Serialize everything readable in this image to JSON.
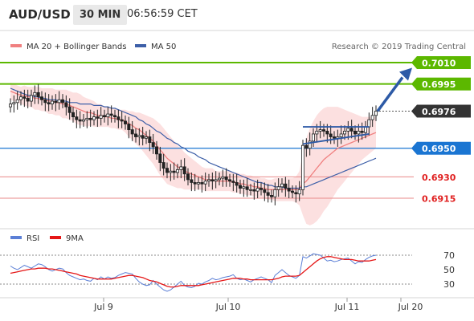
{
  "header": {
    "symbol": "AUD/USD",
    "timeframe": "30 MIN",
    "clock": "06:56:59 CET"
  },
  "legend": {
    "bollinger": "MA 20 + Bollinger Bands",
    "ma50": "MA 50",
    "credit": "Research © 2019 Trading Central",
    "rsi": "RSI",
    "rsi_ma": "9MA"
  },
  "colors": {
    "bollinger": "#f08080",
    "band_fill": "#fbdada",
    "ma50": "#3d5fa8",
    "green_level": "#5cb800",
    "blue_level": "#1a75d2",
    "red_level": "#e88a8a",
    "arrow": "#2d5aa6",
    "current": "#333333",
    "candle": "#222222",
    "rsi": "#5b7fd6",
    "rsi_ma": "#e51616"
  },
  "chart_data": [
    {
      "type": "candlestick",
      "name": "price",
      "levels": [
        {
          "value": 0.701,
          "label": "0.7010",
          "kind": "resistance",
          "color": "#5cb800"
        },
        {
          "value": 0.6995,
          "label": "0.6995",
          "kind": "resistance",
          "color": "#5cb800"
        },
        {
          "value": 0.6976,
          "label": "0.6976",
          "kind": "current",
          "color": "#333333"
        },
        {
          "value": 0.695,
          "label": "0.6950",
          "kind": "pivot",
          "color": "#1a75d2"
        },
        {
          "value": 0.693,
          "label": "0.6930",
          "kind": "support",
          "color": "#e88a8a"
        },
        {
          "value": 0.6915,
          "label": "0.6915",
          "kind": "support",
          "color": "#e88a8a"
        }
      ],
      "x_labels": [
        "Jul 9",
        "Jul 10",
        "Jul 11",
        "Jul 20"
      ],
      "close": [
        0.6981,
        0.6982,
        0.6984,
        0.6986,
        0.6985,
        0.6983,
        0.6987,
        0.6989,
        0.6986,
        0.6984,
        0.6982,
        0.6981,
        0.6983,
        0.6982,
        0.6984,
        0.6982,
        0.6979,
        0.6975,
        0.6972,
        0.697,
        0.6969,
        0.697,
        0.6971,
        0.697,
        0.6972,
        0.6971,
        0.6973,
        0.6972,
        0.6974,
        0.6973,
        0.6972,
        0.697,
        0.6969,
        0.6967,
        0.6963,
        0.696,
        0.6958,
        0.6959,
        0.6957,
        0.6958,
        0.6954,
        0.6951,
        0.6946,
        0.694,
        0.6936,
        0.6933,
        0.6934,
        0.6933,
        0.6935,
        0.6937,
        0.6932,
        0.6928,
        0.6926,
        0.6925,
        0.6926,
        0.6925,
        0.6927,
        0.6928,
        0.6927,
        0.6928,
        0.6929,
        0.693,
        0.6928,
        0.6927,
        0.6926,
        0.6924,
        0.6922,
        0.6923,
        0.6921,
        0.6921,
        0.692,
        0.6922,
        0.6921,
        0.6919,
        0.6917,
        0.6916,
        0.6921,
        0.6923,
        0.6925,
        0.6922,
        0.692,
        0.6919,
        0.6918,
        0.6921,
        0.6952,
        0.695,
        0.6955,
        0.696,
        0.6962,
        0.6963,
        0.6962,
        0.696,
        0.6958,
        0.6957,
        0.6958,
        0.696,
        0.6962,
        0.6964,
        0.6962,
        0.696,
        0.6962,
        0.6961,
        0.6965,
        0.697,
        0.6973,
        0.6976
      ],
      "ma20": [
        0.699,
        0.6989,
        0.6988,
        0.6987,
        0.6987,
        0.6986,
        0.6986,
        0.6985,
        0.6985,
        0.6984,
        0.6984,
        0.6983,
        0.6983,
        0.6982,
        0.6982,
        0.6981,
        0.6981,
        0.698,
        0.6979,
        0.6978,
        0.6977,
        0.6976,
        0.6975,
        0.6975,
        0.6974,
        0.6973,
        0.6973,
        0.6972,
        0.6972,
        0.6971,
        0.6971,
        0.697,
        0.697,
        0.6969,
        0.6967,
        0.6966,
        0.6964,
        0.6963,
        0.6961,
        0.6959,
        0.6957,
        0.6955,
        0.6952,
        0.6949,
        0.6946,
        0.6943,
        0.6941,
        0.6939,
        0.6937,
        0.6936,
        0.6934,
        0.6933,
        0.6932,
        0.6931,
        0.693,
        0.6929,
        0.6928,
        0.6928,
        0.6928,
        0.6927,
        0.6927,
        0.6927,
        0.6927,
        0.6927,
        0.6926,
        0.6926,
        0.6925,
        0.6925,
        0.6924,
        0.6924,
        0.6923,
        0.6923,
        0.6922,
        0.6922,
        0.6921,
        0.6921,
        0.6921,
        0.6921,
        0.6921,
        0.6921,
        0.6921,
        0.6921,
        0.6921,
        0.6922,
        0.6925,
        0.6927,
        0.693,
        0.6933,
        0.6936,
        0.6939,
        0.6942,
        0.6944,
        0.6946,
        0.6948,
        0.695,
        0.6951,
        0.6952,
        0.6953,
        0.6954,
        0.6955,
        0.6956,
        0.6957,
        0.6958,
        0.6959,
        0.696,
        0.6961
      ],
      "ma50": [
        0.6992,
        0.6991,
        0.699,
        0.6989,
        0.6988,
        0.6987,
        0.6987,
        0.6986,
        0.6986,
        0.6985,
        0.6985,
        0.6984,
        0.6984,
        0.6984,
        0.6983,
        0.6983,
        0.6983,
        0.6982,
        0.6982,
        0.6982,
        0.6981,
        0.6981,
        0.6981,
        0.6981,
        0.698,
        0.698,
        0.698,
        0.6979,
        0.6979,
        0.6978,
        0.6978,
        0.6977,
        0.6976,
        0.6975,
        0.6974,
        0.6973,
        0.6972,
        0.697,
        0.6969,
        0.6967,
        0.6966,
        0.6964,
        0.6962,
        0.6961,
        0.6959,
        0.6957,
        0.6956,
        0.6954,
        0.6953,
        0.6951,
        0.695,
        0.6948,
        0.6947,
        0.6946,
        0.6944,
        0.6943,
        0.6942,
        0.694,
        0.6939,
        0.6938,
        0.6937,
        0.6936,
        0.6935,
        0.6934,
        0.6933,
        0.6932,
        0.6931,
        0.693,
        0.6929,
        0.6928,
        0.6927,
        0.6926,
        0.6926,
        0.6925,
        0.6924,
        0.6924,
        0.6923,
        0.6923,
        0.6923,
        0.6922,
        0.6922,
        0.6922,
        0.6922,
        0.6922,
        0.6923,
        0.6923,
        0.6924,
        0.6925,
        0.6926,
        0.6927,
        0.6928,
        0.6929,
        0.693,
        0.6931,
        0.6932,
        0.6933,
        0.6934,
        0.6935,
        0.6936,
        0.6937,
        0.6938,
        0.6939,
        0.694,
        0.6941,
        0.6942,
        0.6943
      ],
      "band_width": [
        0.0006,
        0.0006,
        0.0006,
        0.0006,
        0.0007,
        0.0007,
        0.0007,
        0.0008,
        0.0008,
        0.0008,
        0.0008,
        0.0009,
        0.0009,
        0.0009,
        0.0009,
        0.001,
        0.001,
        0.001,
        0.001,
        0.0011,
        0.0011,
        0.001,
        0.001,
        0.0009,
        0.0009,
        0.0008,
        0.0008,
        0.0007,
        0.0007,
        0.0007,
        0.0007,
        0.0007,
        0.0007,
        0.0008,
        0.0009,
        0.001,
        0.0011,
        0.0012,
        0.0013,
        0.0014,
        0.0015,
        0.0016,
        0.0017,
        0.0018,
        0.0018,
        0.0018,
        0.0017,
        0.0016,
        0.0015,
        0.0014,
        0.0013,
        0.0012,
        0.0011,
        0.001,
        0.0009,
        0.0008,
        0.0008,
        0.0008,
        0.0008,
        0.0007,
        0.0007,
        0.0007,
        0.0007,
        0.0007,
        0.0007,
        0.0007,
        0.0007,
        0.0007,
        0.0007,
        0.0007,
        0.0007,
        0.0007,
        0.0007,
        0.0007,
        0.0007,
        0.0007,
        0.0008,
        0.0008,
        0.0008,
        0.0008,
        0.0008,
        0.0008,
        0.0009,
        0.0012,
        0.0022,
        0.003,
        0.0034,
        0.0036,
        0.0037,
        0.0037,
        0.0036,
        0.0035,
        0.0033,
        0.0031,
        0.0029,
        0.0027,
        0.0025,
        0.0023,
        0.0021,
        0.0019,
        0.0017,
        0.0015,
        0.0014,
        0.0013,
        0.0012,
        0.0011
      ],
      "trendline": {
        "from": {
          "bar": 84,
          "value": 0.6953
        },
        "to": {
          "bar": 103,
          "value": 0.696
        }
      },
      "resistance_line": {
        "from": {
          "bar": 84,
          "value": 0.6965
        },
        "to": {
          "bar": 103,
          "value": 0.6965
        }
      },
      "projection": {
        "from_value": 0.6976,
        "to_value": 0.7003
      }
    },
    {
      "type": "line",
      "name": "rsi",
      "ylim": [
        15,
        85
      ],
      "ticks": [
        "70",
        "50",
        "30"
      ],
      "series": [
        {
          "name": "RSI",
          "values": [
            55,
            52,
            50,
            53,
            56,
            54,
            52,
            55,
            58,
            57,
            54,
            50,
            48,
            50,
            52,
            51,
            46,
            42,
            40,
            38,
            36,
            37,
            35,
            34,
            38,
            36,
            40,
            37,
            40,
            38,
            39,
            42,
            44,
            46,
            45,
            44,
            38,
            33,
            30,
            28,
            29,
            35,
            30,
            26,
            22,
            20,
            22,
            26,
            30,
            34,
            28,
            26,
            25,
            27,
            31,
            30,
            33,
            35,
            38,
            36,
            37,
            39,
            40,
            41,
            43,
            38,
            36,
            37,
            35,
            33,
            36,
            38,
            40,
            38,
            36,
            32,
            42,
            46,
            50,
            46,
            42,
            40,
            38,
            42,
            68,
            66,
            69,
            72,
            71,
            70,
            66,
            62,
            63,
            61,
            62,
            64,
            65,
            66,
            62,
            58,
            61,
            60,
            64,
            67,
            69,
            70
          ]
        },
        {
          "name": "9MA",
          "values": [
            45,
            46,
            47,
            48,
            49,
            50,
            51,
            51,
            52,
            52,
            52,
            51,
            51,
            50,
            49,
            48,
            47,
            46,
            45,
            44,
            42,
            41,
            40,
            39,
            38,
            37,
            37,
            37,
            37,
            37,
            38,
            39,
            40,
            41,
            42,
            42,
            41,
            40,
            39,
            37,
            35,
            34,
            33,
            31,
            29,
            27,
            26,
            26,
            27,
            28,
            28,
            28,
            28,
            28,
            28,
            29,
            30,
            31,
            32,
            33,
            34,
            35,
            36,
            37,
            38,
            38,
            38,
            37,
            37,
            36,
            36,
            36,
            36,
            36,
            36,
            36,
            37,
            38,
            40,
            41,
            41,
            41,
            41,
            42,
            46,
            50,
            54,
            58,
            62,
            65,
            67,
            68,
            68,
            67,
            66,
            65,
            64,
            64,
            64,
            63,
            62,
            62,
            62,
            62,
            63,
            64
          ]
        }
      ]
    }
  ]
}
